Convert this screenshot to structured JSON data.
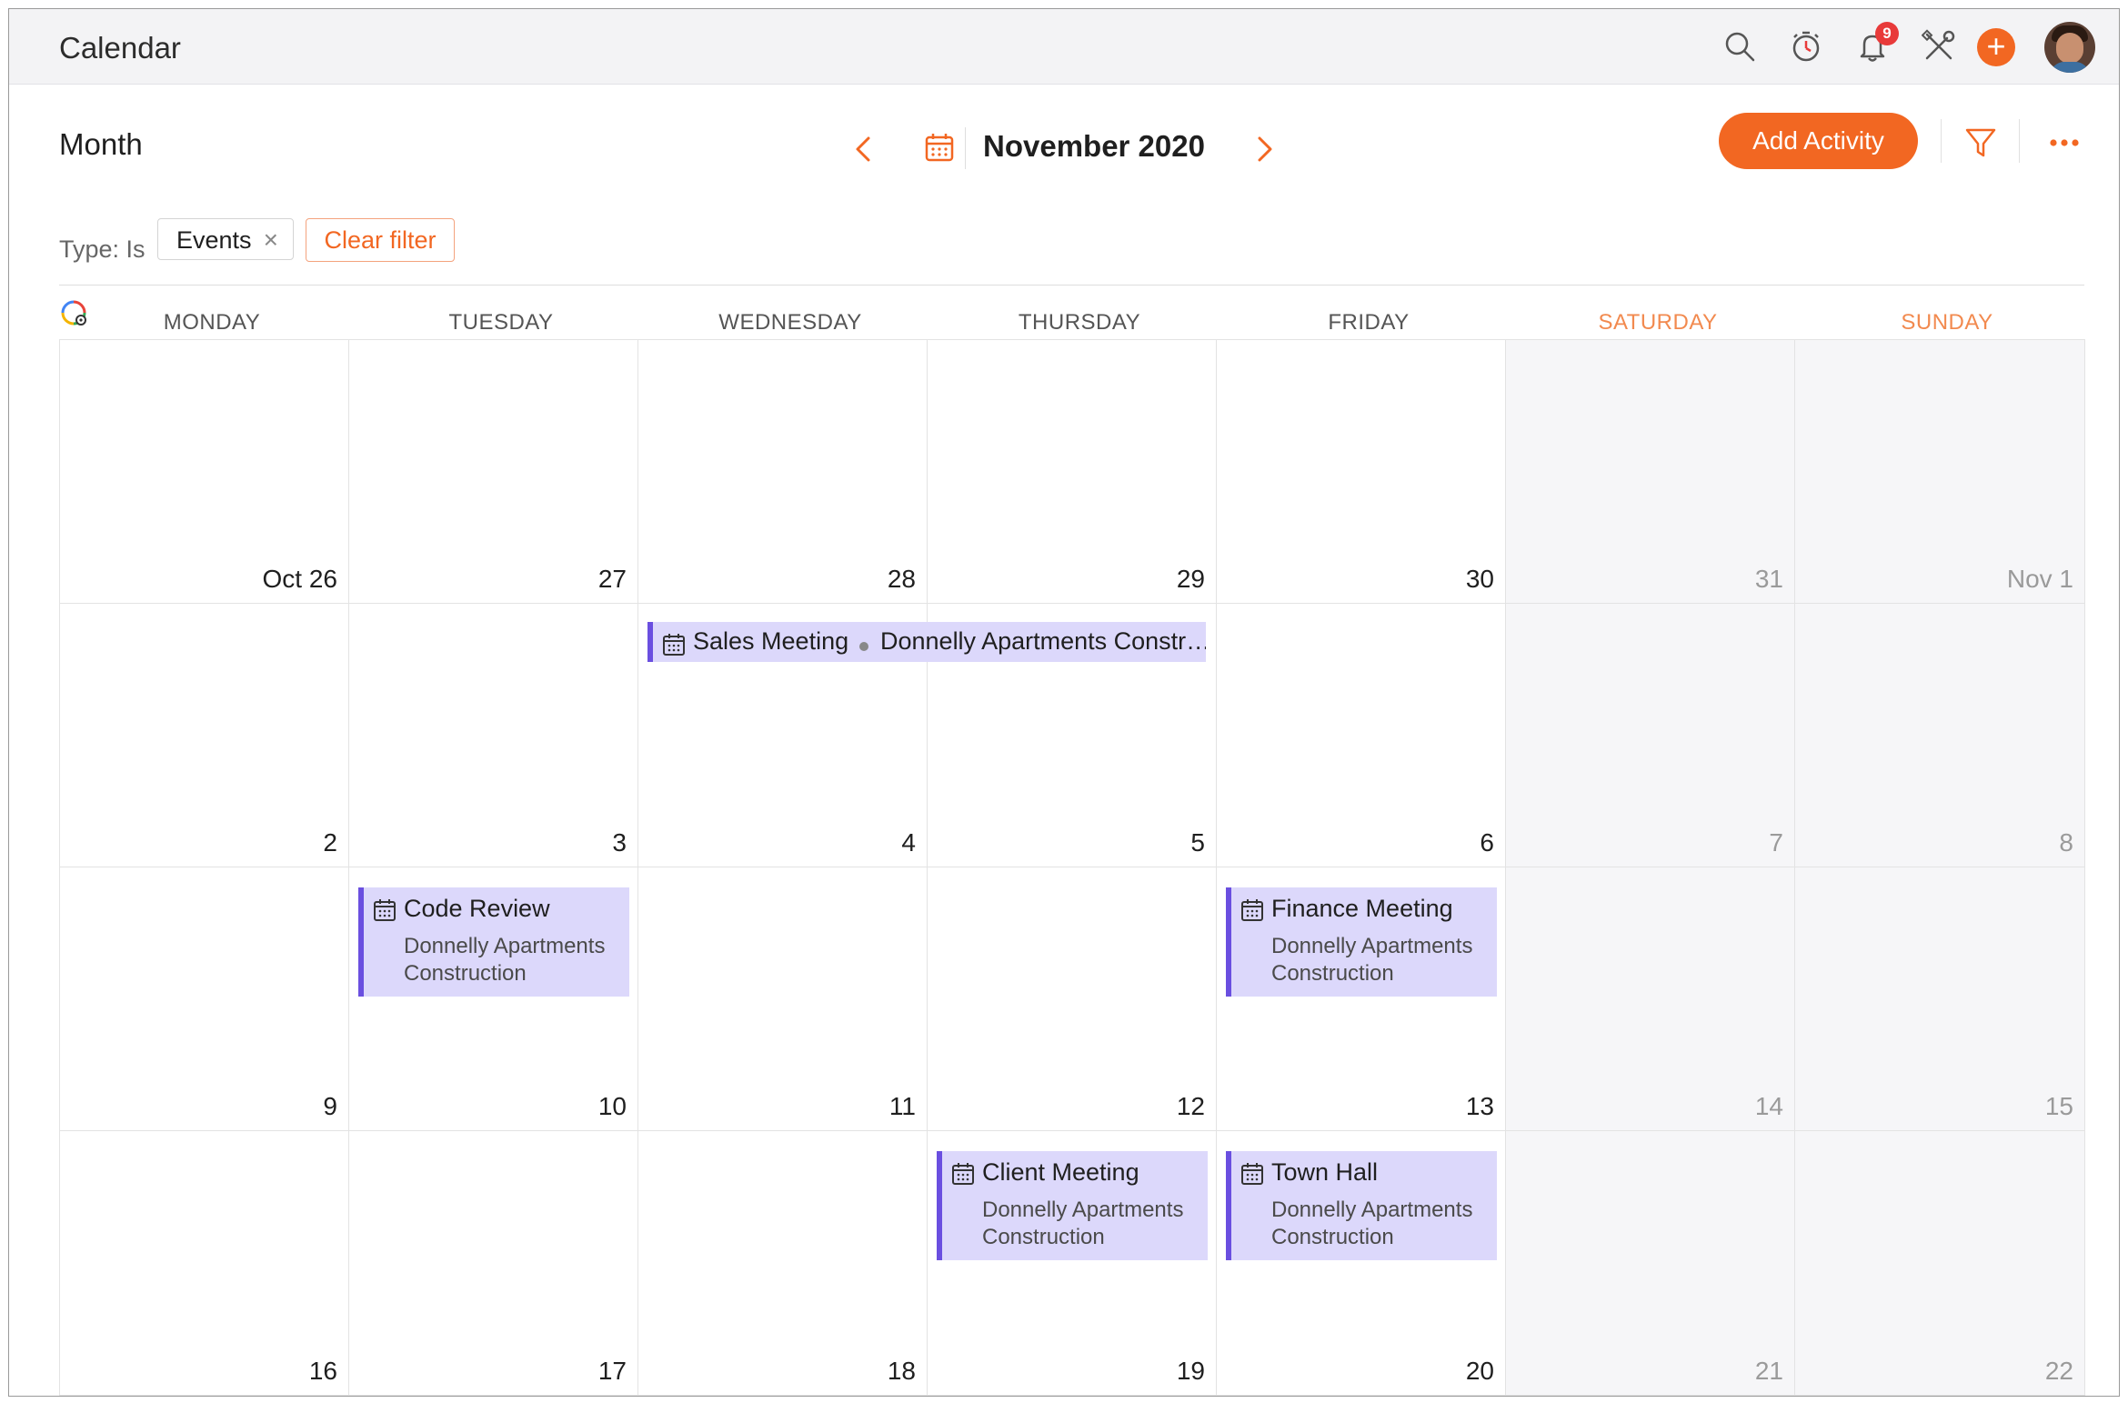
{
  "topbar": {
    "title": "Calendar",
    "notification_count": "9",
    "icons": [
      "search-icon",
      "timer-icon",
      "bell-icon",
      "tools-icon",
      "plus-icon",
      "avatar"
    ]
  },
  "toolbar": {
    "view": "Month",
    "month_label": "November 2020",
    "add_activity": "Add Activity"
  },
  "filter": {
    "type_label": "Type: Is",
    "chip_label": "Events",
    "chip_remove": "×",
    "clear_label": "Clear filter"
  },
  "weekdays": [
    "MONDAY",
    "TUESDAY",
    "WEDNESDAY",
    "THURSDAY",
    "FRIDAY",
    "SATURDAY",
    "SUNDAY"
  ],
  "weeks": [
    [
      "Oct 26",
      "27",
      "28",
      "29",
      "30",
      "31",
      "Nov 1"
    ],
    [
      "2",
      "3",
      "4",
      "5",
      "6",
      "7",
      "8"
    ],
    [
      "9",
      "10",
      "11",
      "12",
      "13",
      "14",
      "15"
    ],
    [
      "16",
      "17",
      "18",
      "19",
      "20",
      "21",
      "22"
    ]
  ],
  "events": {
    "sales": {
      "title": "Sales Meeting",
      "project": "Donnelly Apartments Constr…"
    },
    "code_review": {
      "title": "Code Review",
      "project": "Donnelly Apartments Construction"
    },
    "finance": {
      "title": "Finance Meeting",
      "project": "Donnelly Apartments Construction"
    },
    "client": {
      "title": "Client Meeting",
      "project": "Donnelly Apartments Construction"
    },
    "town_hall": {
      "title": "Town Hall",
      "project": "Donnelly Apartments Construction"
    }
  },
  "colors": {
    "accent": "#f26722",
    "event_bg": "#dcd8fb",
    "event_border": "#6a4fe0",
    "weekend_bg": "#f6f6f8",
    "weekend_text": "#f28a4f"
  }
}
